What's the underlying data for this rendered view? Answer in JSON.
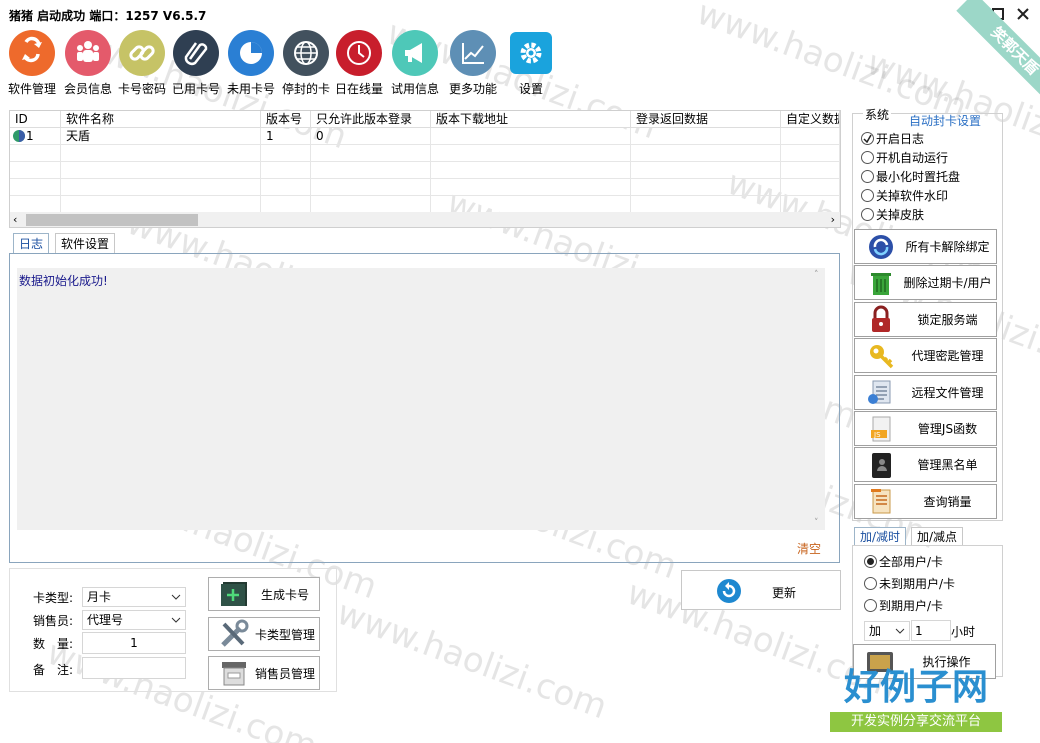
{
  "title": "猪猪  启动成功   端口：1257 V6.5.7",
  "toolbar": [
    {
      "label": "软件管理",
      "icon": "refresh-icon",
      "color": "#ee6a2c"
    },
    {
      "label": "会员信息",
      "icon": "users-icon",
      "color": "#e45a6b"
    },
    {
      "label": "卡号密码",
      "icon": "link-icon",
      "color": "#c6c366"
    },
    {
      "label": "已用卡号",
      "icon": "paperclip-icon",
      "color": "#2f3f52"
    },
    {
      "label": "未用卡号",
      "icon": "pie-icon",
      "color": "#2a7fd4"
    },
    {
      "label": "停封的卡",
      "icon": "globe-icon",
      "color": "#42515e"
    },
    {
      "label": "日在线量",
      "icon": "clock-icon",
      "color": "#c81e2c"
    },
    {
      "label": "试用信息",
      "icon": "megaphone-icon",
      "color": "#4ec8b8"
    },
    {
      "label": "更多功能",
      "icon": "chart-icon",
      "color": "#5e8fb5"
    },
    {
      "label": "设置",
      "icon": "gear-icon",
      "color": "#1aa3dd"
    }
  ],
  "ribbon_text": "笑郭天盾",
  "grid": {
    "headers": [
      "ID",
      "软件名称",
      "版本号",
      "只允许此版本登录",
      "版本下载地址",
      "登录返回数据",
      "自定义数据"
    ],
    "rows": [
      [
        "1",
        "天盾",
        "1",
        "0",
        "",
        "",
        ""
      ]
    ]
  },
  "tabs": {
    "log": "日志",
    "settings": "软件设置"
  },
  "log": {
    "message": "数据初始化成功!",
    "clear": "清空"
  },
  "form": {
    "card_type_label": "卡类型:",
    "card_type_value": "月卡",
    "seller_label": "销售员:",
    "seller_value": "代理号",
    "qty_label": "数　量:",
    "qty_value": "1",
    "note_label": "备　注:",
    "note_value": ""
  },
  "buttons": {
    "generate": "生成卡号",
    "card_type_mgmt": "卡类型管理",
    "seller_mgmt": "销售员管理",
    "update": "更新"
  },
  "system": {
    "title": "系统",
    "auto_ban": "自动封卡设置",
    "options": [
      {
        "label": "开启日志",
        "checked": true
      },
      {
        "label": "开机自动运行",
        "checked": false
      },
      {
        "label": "最小化时置托盘",
        "checked": false
      },
      {
        "label": "关掉软件水印",
        "checked": false
      },
      {
        "label": "关掉皮肤",
        "checked": false
      }
    ],
    "buttons": [
      {
        "label": "所有卡解除绑定",
        "icon": "unbind-icon"
      },
      {
        "label": "删除过期卡/用户",
        "icon": "trash-icon"
      },
      {
        "label": "锁定服务端",
        "icon": "lock-icon"
      },
      {
        "label": "代理密匙管理",
        "icon": "key-icon"
      },
      {
        "label": "远程文件管理",
        "icon": "file-icon"
      },
      {
        "label": "管理JS函数",
        "icon": "js-file-icon"
      },
      {
        "label": "管理黑名单",
        "icon": "blacklist-icon"
      },
      {
        "label": "查询销量",
        "icon": "sales-icon"
      }
    ]
  },
  "addsub": {
    "tab_time": "加/减时",
    "tab_points": "加/减点",
    "options": [
      {
        "label": "全部用户/卡",
        "checked": true
      },
      {
        "label": "未到期用户/卡",
        "checked": false
      },
      {
        "label": "到期用户/卡",
        "checked": false
      }
    ],
    "op_value": "加",
    "amount": "1",
    "unit": "小时",
    "execute": "执行操作"
  },
  "watermark": "www.haolizi.com",
  "brand": {
    "title": "好例子网",
    "subtitle": "开发实例分享交流平台"
  }
}
